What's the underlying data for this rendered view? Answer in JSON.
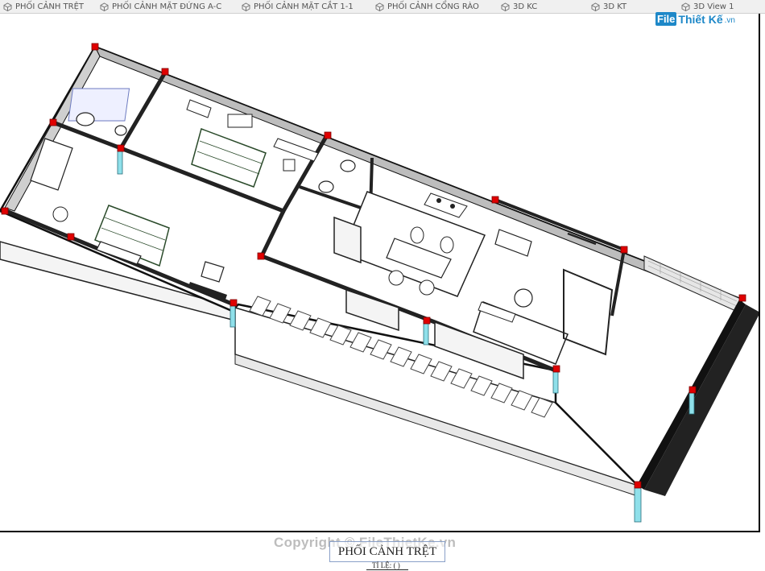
{
  "tabs": [
    {
      "label": "PHỐI CẢNH TRỆT",
      "icon": "view-3d-icon"
    },
    {
      "label": "PHỐI CẢNH MẶT ĐỨNG A-C",
      "icon": "view-3d-icon"
    },
    {
      "label": "PHỐI CẢNH MẶT CẮT 1-1",
      "icon": "view-3d-icon"
    },
    {
      "label": "PHỐI CẢNH CỔNG RÀO",
      "icon": "view-3d-icon"
    },
    {
      "label": "3D KC",
      "icon": "view-3d-icon"
    },
    {
      "label": "3D KT",
      "icon": "view-3d-icon"
    },
    {
      "label": "3D View 1",
      "icon": "view-3d-icon"
    }
  ],
  "logo": {
    "mark": "File",
    "name": "Thiết Kế",
    "tld": ".vn"
  },
  "watermark": "Copyright © FileThietKe.vn",
  "view_title": "PHỐI CẢNH TRỆT",
  "scale_label": "TỈ LỆ: ( )",
  "colors": {
    "column": "#e00000",
    "glass": "#8fe0ea",
    "wall": "#1a1a1a",
    "floor": "#ffffff",
    "accent": "#1e88c8"
  }
}
